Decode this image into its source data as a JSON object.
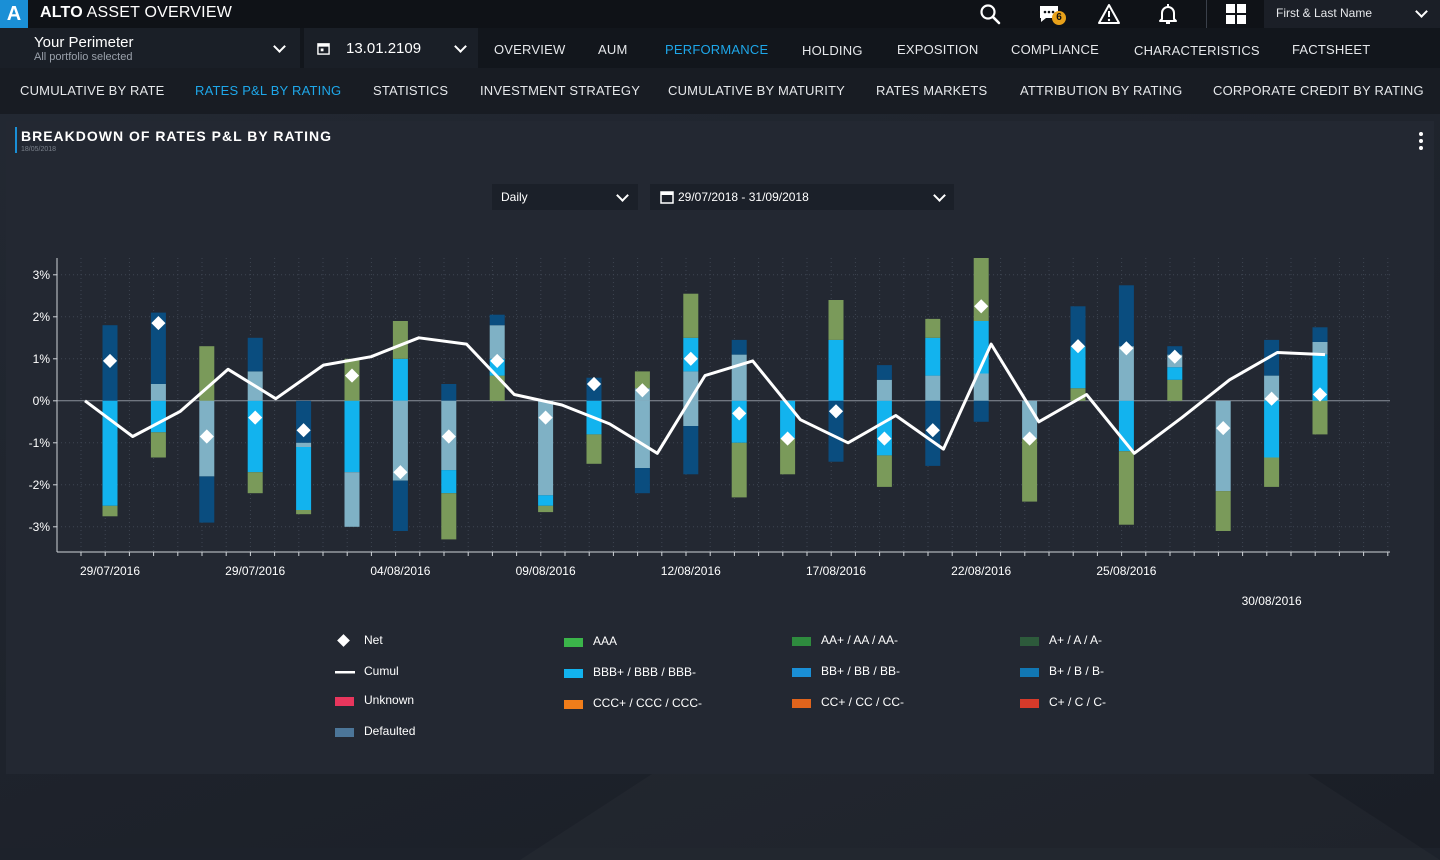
{
  "app": {
    "logo": "A",
    "title_bold": "ALTO",
    "title_rest": " ASSET OVERVIEW"
  },
  "topbar": {
    "icons": [
      "search-icon",
      "chat-icon",
      "warning-icon",
      "bell-icon",
      "grid-icon",
      "chevron-down-icon"
    ],
    "notification_count": "6",
    "user_name": "First & Last Name"
  },
  "perimeter": {
    "title": "Your Perimeter",
    "subtitle": "All portfolio selected"
  },
  "date_selector": {
    "value": "13.01.2109"
  },
  "nav": [
    {
      "label": "OVERVIEW",
      "active": false
    },
    {
      "label": "AUM",
      "active": false
    },
    {
      "label": "PERFORMANCE",
      "active": true
    },
    {
      "label": "HOLDING",
      "active": false
    },
    {
      "label": "EXPOSITION",
      "active": false
    },
    {
      "label": "COMPLIANCE",
      "active": false
    },
    {
      "label": "CHARACTERISTICS",
      "active": false
    },
    {
      "label": "FACTSHEET",
      "active": false
    }
  ],
  "subnav": [
    {
      "label": "CUMULATIVE BY RATE",
      "active": false
    },
    {
      "label": "RATES P&L BY RATING",
      "active": true
    },
    {
      "label": "STATISTICS",
      "active": false
    },
    {
      "label": "INVESTMENT STRATEGY",
      "active": false
    },
    {
      "label": "CUMULATIVE BY MATURITY",
      "active": false
    },
    {
      "label": "RATES MARKETS",
      "active": false
    },
    {
      "label": "ATTRIBUTION BY RATING",
      "active": false
    },
    {
      "label": "CORPORATE CREDIT  BY RATING",
      "active": false
    }
  ],
  "panel": {
    "title": "BREAKDOWN OF RATES P&L BY RATING",
    "date": "18/05/2018",
    "frequency": "Daily",
    "range": "29/07/2018 - 31/09/2018"
  },
  "colors": {
    "AAA": "#3bb54a",
    "AA": "#2e8b3e",
    "A": "#2d5a3b",
    "BBB": "#12b3ee",
    "BB": "#1a8fd6",
    "B": "#1177b3",
    "CCC": "#f07d1a",
    "CC": "#e0641c",
    "C": "#d63a2a",
    "Unknown": "#e8365d",
    "Defaulted": "#4c7699",
    "green": "#7a9a5a",
    "cyan": "#12b3ee",
    "lightblue": "#7fb1c5",
    "navy": "#0a4d7f",
    "net": "#ffffff",
    "cumul": "#ffffff"
  },
  "legend": [
    {
      "key": "net",
      "label": "Net",
      "kind": "diamond"
    },
    {
      "key": "cumul",
      "label": "Cumul",
      "kind": "line"
    },
    {
      "key": "Unknown",
      "label": "Unknown",
      "kind": "box"
    },
    {
      "key": "Defaulted",
      "label": "Defaulted",
      "kind": "box"
    },
    {
      "key": "AAA",
      "label": "AAA",
      "kind": "box"
    },
    {
      "key": "BBB",
      "label": "BBB+ / BBB / BBB-",
      "kind": "box"
    },
    {
      "key": "CCC",
      "label": "CCC+ / CCC / CCC-",
      "kind": "box"
    },
    {
      "key": "AA",
      "label": "AA+ / AA / AA-",
      "kind": "box"
    },
    {
      "key": "BB",
      "label": "BB+ / BB / BB-",
      "kind": "box"
    },
    {
      "key": "CC",
      "label": "CC+ / CC / CC-",
      "kind": "box"
    },
    {
      "key": "A",
      "label": "A+ / A / A-",
      "kind": "box"
    },
    {
      "key": "B",
      "label": "B+ / B / B-",
      "kind": "box"
    },
    {
      "key": "C",
      "label": "C+ / C / C-",
      "kind": "box"
    }
  ],
  "chart_data": {
    "type": "bar",
    "stacked": true,
    "grid": true,
    "ylim": [
      -3.6,
      3.4
    ],
    "y_ticks": [
      "3%",
      "2%",
      "1%",
      "0%",
      "-1%",
      "-2%",
      "-3%"
    ],
    "y_tick_values": [
      3,
      2,
      1,
      0,
      -1,
      -2,
      -3
    ],
    "x_tick_labels": [
      "29/07/2016",
      "29/07/2016",
      "04/08/2016",
      "09/08/2016",
      "12/08/2016",
      "17/08/2016",
      "22/08/2016",
      "25/08/2016",
      "30/08/2016"
    ],
    "x_tick_label_at": [
      1,
      4,
      7,
      10,
      13,
      16,
      19,
      22,
      25
    ],
    "segment_colors": [
      "navy",
      "lightblue",
      "cyan",
      "green"
    ],
    "bars": [
      {
        "pos": [
          [
            "navy",
            1.8
          ]
        ],
        "neg": [
          [
            "cyan",
            -2.5
          ],
          [
            "green",
            -0.25
          ]
        ],
        "net": 0.95
      },
      {
        "pos": [
          [
            "lightblue",
            0.4
          ],
          [
            "navy",
            1.7
          ]
        ],
        "neg": [
          [
            "cyan",
            -0.75
          ],
          [
            "green",
            -0.6
          ]
        ],
        "net": 1.85
      },
      {
        "pos": [
          [
            "green",
            1.3
          ]
        ],
        "neg": [
          [
            "lightblue",
            -1.8
          ],
          [
            "navy",
            -1.1
          ]
        ],
        "net": -0.85
      },
      {
        "pos": [
          [
            "lightblue",
            0.7
          ],
          [
            "navy",
            0.8
          ]
        ],
        "neg": [
          [
            "cyan",
            -1.7
          ],
          [
            "green",
            -0.5
          ]
        ],
        "net": -0.4
      },
      {
        "pos": [],
        "neg": [
          [
            "navy",
            -1.0
          ],
          [
            "lightblue",
            -0.1
          ],
          [
            "cyan",
            -1.5
          ],
          [
            "green",
            -0.1
          ]
        ],
        "net": -0.7
      },
      {
        "pos": [
          [
            "green",
            1.0
          ]
        ],
        "neg": [
          [
            "cyan",
            -1.7
          ],
          [
            "lightblue",
            -1.3
          ]
        ],
        "net": 0.6
      },
      {
        "pos": [
          [
            "cyan",
            1.0
          ],
          [
            "green",
            0.9
          ]
        ],
        "neg": [
          [
            "lightblue",
            -1.9
          ],
          [
            "navy",
            -1.2
          ]
        ],
        "net": -1.7
      },
      {
        "pos": [
          [
            "navy",
            0.4
          ]
        ],
        "neg": [
          [
            "lightblue",
            -1.65
          ],
          [
            "cyan",
            -0.55
          ],
          [
            "green",
            -1.1
          ]
        ],
        "net": -0.85
      },
      {
        "pos": [
          [
            "green",
            0.6
          ],
          [
            "cyan",
            0.4
          ],
          [
            "lightblue",
            0.8
          ],
          [
            "navy",
            0.25
          ]
        ],
        "neg": [],
        "net": 0.95
      },
      {
        "pos": [],
        "neg": [
          [
            "lightblue",
            -2.25
          ],
          [
            "cyan",
            -0.25
          ],
          [
            "green",
            -0.15
          ]
        ],
        "net": -0.4
      },
      {
        "pos": [
          [
            "navy",
            0.55
          ]
        ],
        "neg": [
          [
            "cyan",
            -0.8
          ],
          [
            "green",
            -0.7
          ]
        ],
        "net": 0.4
      },
      {
        "pos": [
          [
            "lightblue",
            0.3
          ],
          [
            "green",
            0.4
          ]
        ],
        "neg": [
          [
            "lightblue",
            -1.6
          ],
          [
            "navy",
            -0.6
          ]
        ],
        "net": 0.25
      },
      {
        "pos": [
          [
            "lightblue",
            0.7
          ],
          [
            "cyan",
            0.8
          ],
          [
            "green",
            1.05
          ]
        ],
        "neg": [
          [
            "lightblue",
            -0.6
          ],
          [
            "navy",
            -1.15
          ]
        ],
        "net": 1.0
      },
      {
        "pos": [
          [
            "lightblue",
            1.1
          ],
          [
            "navy",
            0.35
          ]
        ],
        "neg": [
          [
            "cyan",
            -1.0
          ],
          [
            "green",
            -1.3
          ]
        ],
        "net": -0.3
      },
      {
        "pos": [],
        "neg": [
          [
            "cyan",
            -0.9
          ],
          [
            "green",
            -0.85
          ]
        ],
        "net": -0.9
      },
      {
        "pos": [
          [
            "cyan",
            1.45
          ],
          [
            "green",
            0.95
          ]
        ],
        "neg": [
          [
            "navy",
            -1.45
          ]
        ],
        "net": -0.25
      },
      {
        "pos": [
          [
            "lightblue",
            0.5
          ],
          [
            "navy",
            0.35
          ]
        ],
        "neg": [
          [
            "cyan",
            -1.3
          ],
          [
            "green",
            -0.75
          ]
        ],
        "net": -0.9
      },
      {
        "pos": [
          [
            "lightblue",
            0.6
          ],
          [
            "cyan",
            0.9
          ],
          [
            "green",
            0.45
          ]
        ],
        "neg": [
          [
            "navy",
            -1.55
          ]
        ],
        "net": -0.7
      },
      {
        "pos": [
          [
            "lightblue",
            0.65
          ],
          [
            "cyan",
            1.25
          ],
          [
            "green",
            1.5
          ]
        ],
        "neg": [
          [
            "navy",
            -0.5
          ]
        ],
        "net": 2.25
      },
      {
        "pos": [],
        "neg": [
          [
            "lightblue",
            -0.9
          ],
          [
            "green",
            -1.5
          ]
        ],
        "net": -0.9
      },
      {
        "pos": [
          [
            "green",
            0.3
          ],
          [
            "cyan",
            1.0
          ],
          [
            "navy",
            0.95
          ]
        ],
        "neg": [],
        "net": 1.3
      },
      {
        "pos": [
          [
            "lightblue",
            1.3
          ],
          [
            "navy",
            1.45
          ]
        ],
        "neg": [
          [
            "cyan",
            -1.2
          ],
          [
            "green",
            -1.75
          ]
        ],
        "net": 1.25
      },
      {
        "pos": [
          [
            "green",
            0.5
          ],
          [
            "cyan",
            0.3
          ],
          [
            "lightblue",
            0.3
          ],
          [
            "navy",
            0.2
          ]
        ],
        "neg": [],
        "net": 1.05
      },
      {
        "pos": [],
        "neg": [
          [
            "lightblue",
            -2.15
          ],
          [
            "green",
            -0.95
          ]
        ],
        "net": -0.65
      },
      {
        "pos": [
          [
            "lightblue",
            0.6
          ],
          [
            "navy",
            0.85
          ]
        ],
        "neg": [
          [
            "cyan",
            -1.35
          ],
          [
            "green",
            -0.7
          ]
        ],
        "net": 0.05
      },
      {
        "pos": [
          [
            "cyan",
            1.1
          ],
          [
            "lightblue",
            0.3
          ],
          [
            "navy",
            0.35
          ]
        ],
        "neg": [
          [
            "green",
            -0.8
          ]
        ],
        "net": 0.15
      }
    ],
    "cumul": [
      0.0,
      -0.85,
      -0.25,
      0.75,
      0.05,
      0.85,
      1.05,
      1.5,
      1.35,
      0.15,
      -0.1,
      -0.55,
      -1.25,
      0.6,
      0.95,
      -0.45,
      -1.0,
      -0.35,
      -1.15,
      1.35,
      -0.5,
      0.15,
      -1.25,
      -0.4,
      0.5,
      1.15,
      1.1
    ]
  }
}
